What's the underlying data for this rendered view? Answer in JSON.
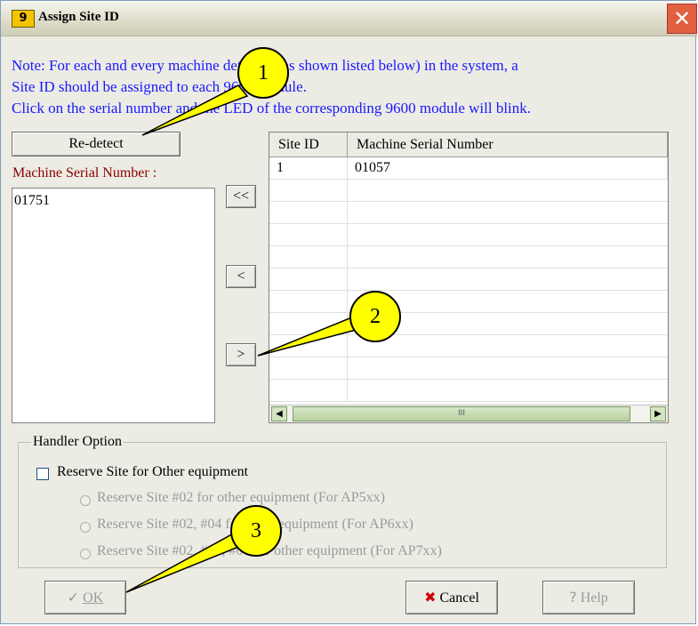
{
  "window": {
    "title": "Assign Site ID",
    "icon_text": "9",
    "close_glyph": "✕"
  },
  "note": {
    "line1": "Note: For each and every machine detected (as shown listed below) in the system, a",
    "line2": "Site ID should be assigned to each 9600 module.",
    "line3": "Click on the serial number and the LED of the corresponding 9600 module will blink."
  },
  "left_panel": {
    "redetect_label": "Re-detect",
    "machine_label": "Machine Serial Number :",
    "items": [
      "01751"
    ]
  },
  "move_buttons": {
    "move_all_left": "<<",
    "move_left": "<",
    "move_right": ">"
  },
  "table": {
    "columns": [
      "Site ID",
      "Machine Serial Number"
    ],
    "rows": [
      {
        "site_id": "1",
        "serial": "01057"
      }
    ],
    "scroll_thumb_grip": "III",
    "scroll_left_glyph": "◀",
    "scroll_right_glyph": "▶"
  },
  "handler": {
    "group_title": "Handler Option",
    "checkbox_label": "Reserve Site for Other equipment",
    "checked": false,
    "options": [
      "Reserve Site #02 for other equipment (For AP5xx)",
      "Reserve Site #02, #04 for other equipment (For AP6xx)",
      "Reserve Site #02, #03, #04 for other equipment (For AP7xx)"
    ]
  },
  "footer": {
    "ok_label": "OK",
    "cancel_label": "Cancel",
    "help_label": "Help"
  },
  "callouts": [
    "1",
    "2",
    "3"
  ],
  "colors": {
    "note_text": "#1a1aff",
    "label_text": "#8b0000",
    "callout_fill": "#ffff00",
    "cancel_icon": "#cc0000"
  }
}
